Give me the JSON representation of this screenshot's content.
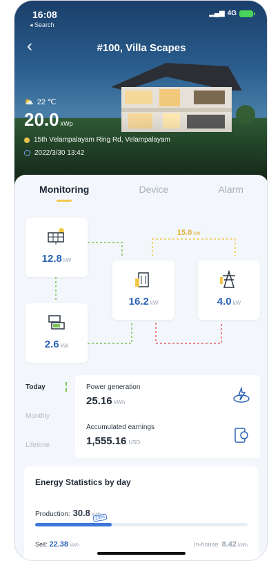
{
  "status_bar": {
    "time": "16:08",
    "back_app": "◂ Search",
    "network": "4G"
  },
  "header": {
    "title": "#100, Villa Scapes"
  },
  "hero": {
    "temperature": "22 ℃",
    "current_power": "20.0",
    "current_power_unit": "kWp",
    "address": "15th Velampalayam Ring Rd, Velampalayam",
    "datetime": "2022/3/30 13:42"
  },
  "tabs": [
    {
      "label": "Monitoring",
      "active": true
    },
    {
      "label": "Device",
      "active": false
    },
    {
      "label": "Alarm",
      "active": false
    }
  ],
  "flow": {
    "solar": {
      "value": "12.8",
      "unit": "kW",
      "icon": "solar-panel-icon"
    },
    "building": {
      "value": "16.2",
      "unit": "kW",
      "icon": "building-icon"
    },
    "grid": {
      "value": "4.0",
      "unit": "kW",
      "icon": "power-tower-icon"
    },
    "battery": {
      "value": "2.6",
      "unit": "kW",
      "icon": "battery-icon"
    },
    "grid_flow": {
      "value": "15.0",
      "unit": "kW"
    }
  },
  "periods": [
    "Today",
    "Monthly",
    "Lifetime"
  ],
  "stats": {
    "generation_label": "Power generation",
    "generation_value": "25.16",
    "generation_unit": "kWh",
    "earnings_label": "Accumulated earnings",
    "earnings_value": "1,555.16",
    "earnings_unit": "USD"
  },
  "energy": {
    "title": "Energy Statistics by day",
    "production_label": "Production:",
    "production_value": "30.8",
    "production_unit": "kWh",
    "production_share": 0.36,
    "bar_tag": "29%",
    "sell_label": "Sell:",
    "sell_value": "22.38",
    "sell_unit": "kWh",
    "inhouse_label": "In-house:",
    "inhouse_value": "8.42",
    "inhouse_unit": "kWh"
  },
  "colors": {
    "accent_blue": "#2a63b6",
    "accent_yellow": "#f2c94c",
    "flow_green": "#7ac35a",
    "flow_red": "#e5646a"
  }
}
